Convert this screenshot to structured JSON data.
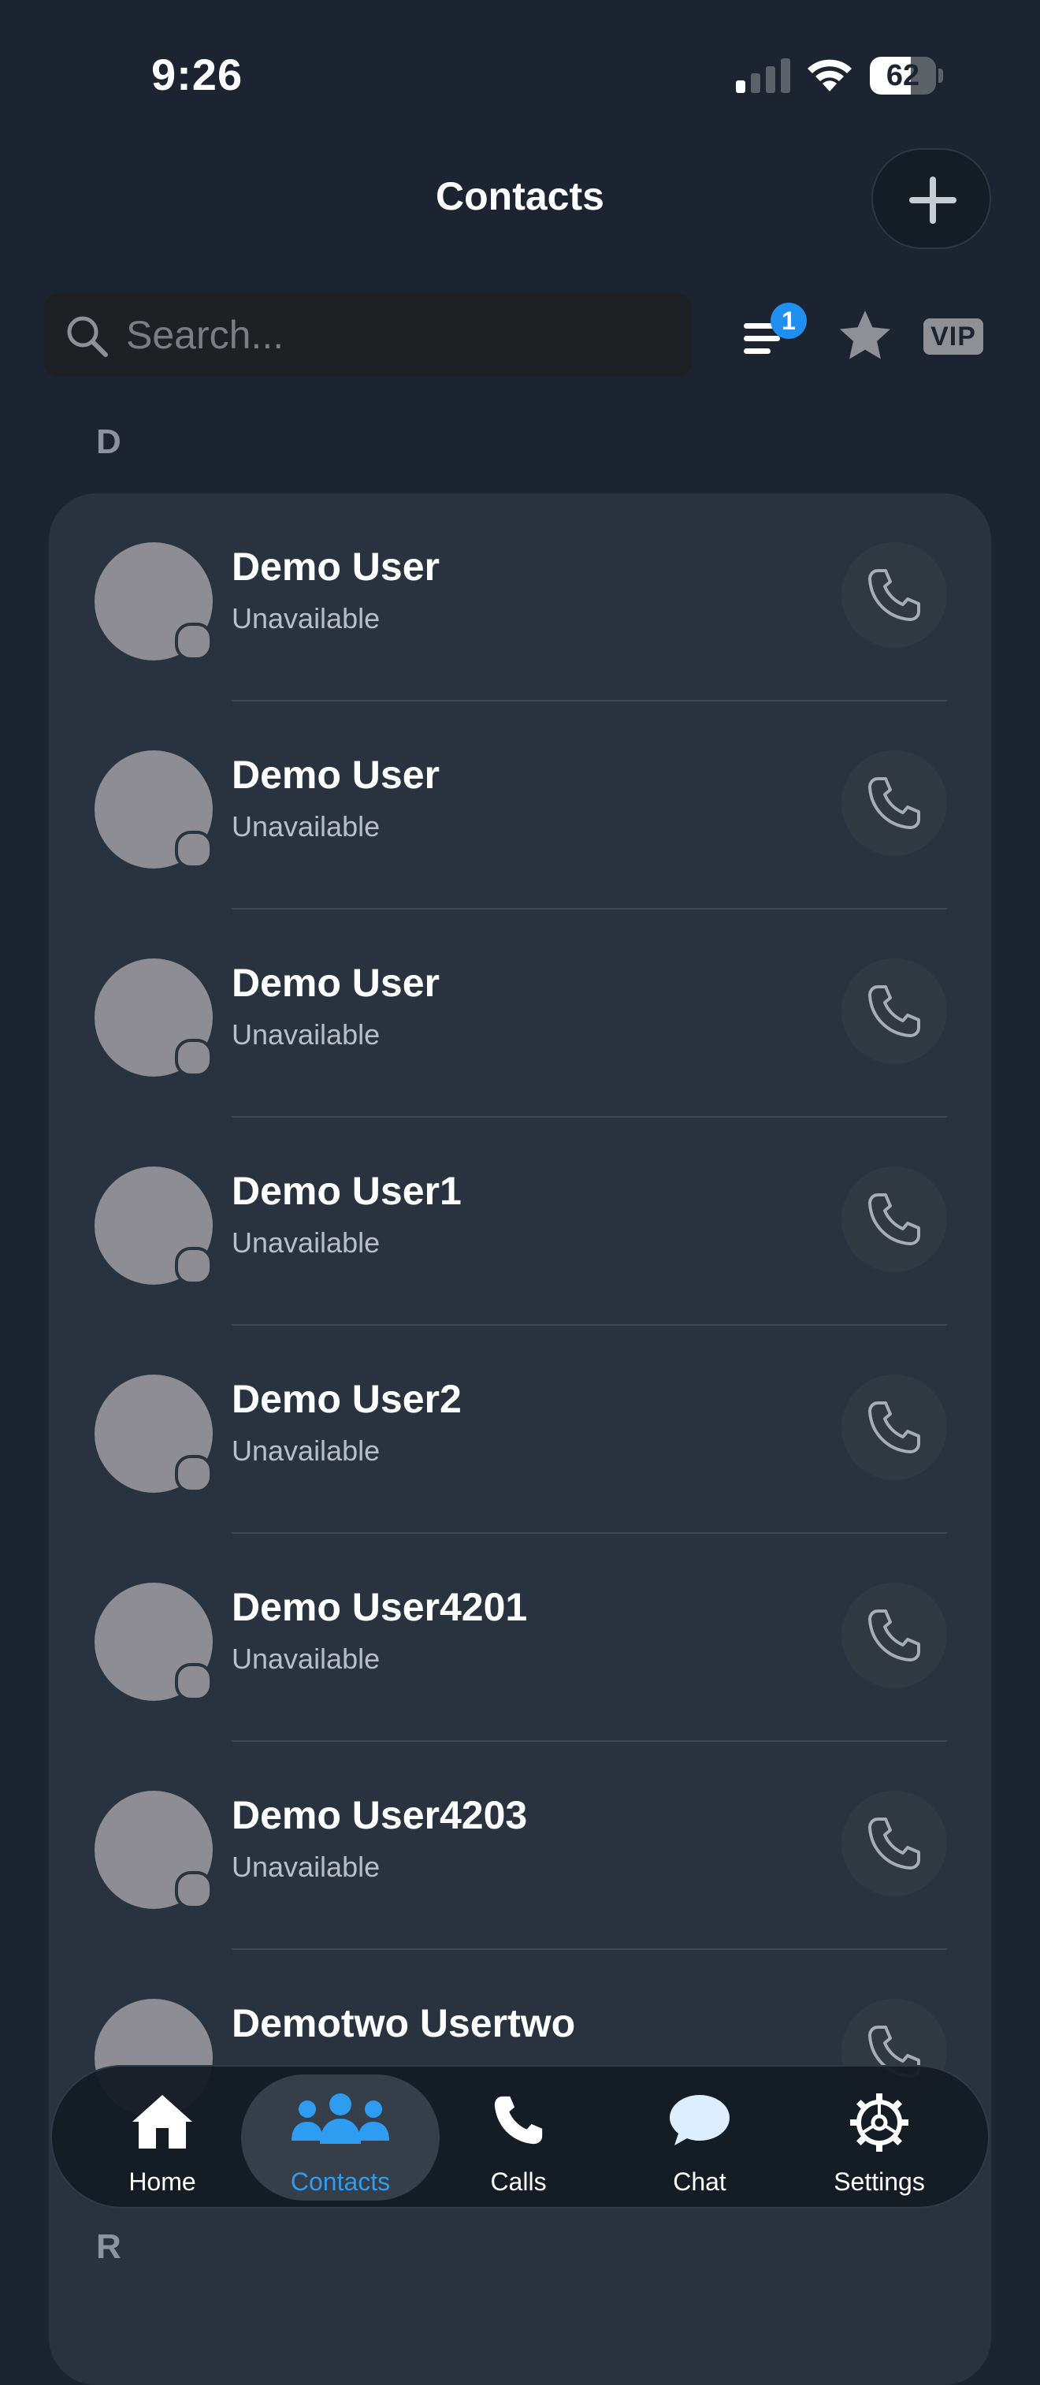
{
  "status_bar": {
    "time": "9:26",
    "battery_percent": 62,
    "battery_label": "62",
    "signal_bars_active": 1,
    "signal_bars_total": 4
  },
  "header": {
    "title": "Contacts",
    "add_icon": "plus-icon"
  },
  "search": {
    "placeholder": "Search...",
    "value": ""
  },
  "filters": {
    "filter_icon": "filter-lines-icon",
    "filter_badge": "1",
    "favorites_icon": "star-icon",
    "vip_label": "VIP"
  },
  "sections": [
    {
      "letter": "D",
      "contacts": [
        {
          "name": "Demo User",
          "status": "Unavailable"
        },
        {
          "name": "Demo User",
          "status": "Unavailable"
        },
        {
          "name": "Demo User",
          "status": "Unavailable"
        },
        {
          "name": "Demo User1",
          "status": "Unavailable"
        },
        {
          "name": "Demo User2",
          "status": "Unavailable"
        },
        {
          "name": "Demo User4201",
          "status": "Unavailable"
        },
        {
          "name": "Demo User4203",
          "status": "Unavailable"
        },
        {
          "name": "Demotwo Usertwo",
          "status": ""
        }
      ]
    },
    {
      "letter": "R"
    }
  ],
  "tab_bar": {
    "active": "contacts",
    "tabs": [
      {
        "id": "home",
        "label": "Home",
        "icon": "home-icon"
      },
      {
        "id": "contacts",
        "label": "Contacts",
        "icon": "people-icon"
      },
      {
        "id": "calls",
        "label": "Calls",
        "icon": "phone-icon"
      },
      {
        "id": "chat",
        "label": "Chat",
        "icon": "chat-bubble-icon"
      },
      {
        "id": "settings",
        "label": "Settings",
        "icon": "gear-icon"
      }
    ]
  },
  "colors": {
    "background": "#1b2430",
    "card": "#29333f",
    "accent": "#2e9cf0",
    "badge": "#1f8ff0",
    "avatar": "#8e8d93"
  }
}
